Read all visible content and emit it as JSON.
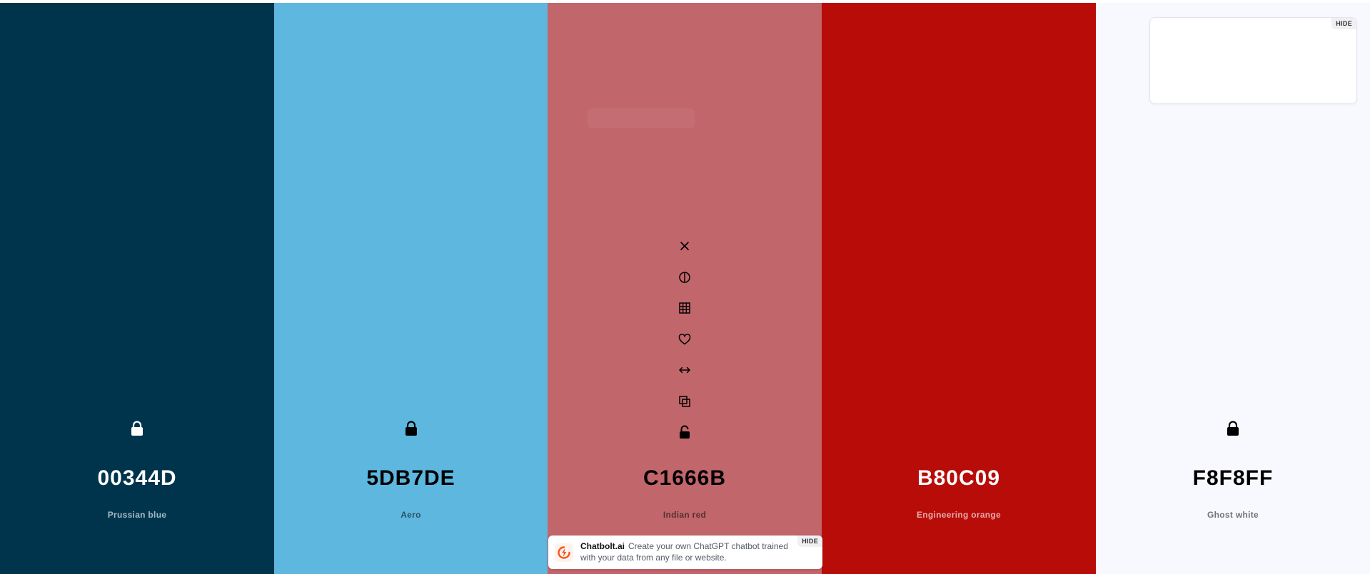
{
  "swatches": [
    {
      "hex": "00344D",
      "name": "Prussian blue",
      "color": "#00344D"
    },
    {
      "hex": "5DB7DE",
      "name": "Aero",
      "color": "#5DB7DE"
    },
    {
      "hex": "C1666B",
      "name": "Indian red",
      "color": "#C1666B"
    },
    {
      "hex": "B80C09",
      "name": "Engineering orange",
      "color": "#B80C09"
    },
    {
      "hex": "F8F8FF",
      "name": "Ghost white",
      "color": "#F8F8FF"
    }
  ],
  "tools": [
    "close-icon",
    "contrast-icon",
    "shades-grid-icon",
    "heart-icon",
    "drag-arrows-icon",
    "copy-icon",
    "lock-open-icon"
  ],
  "ad": {
    "hide_label": "HIDE"
  },
  "banner": {
    "brand": "Chatbolt.ai",
    "text": "Create your own ChatGPT chatbot trained with your data from any file or website.",
    "hide_label": "HIDE",
    "logo_color": "#F2561D"
  }
}
